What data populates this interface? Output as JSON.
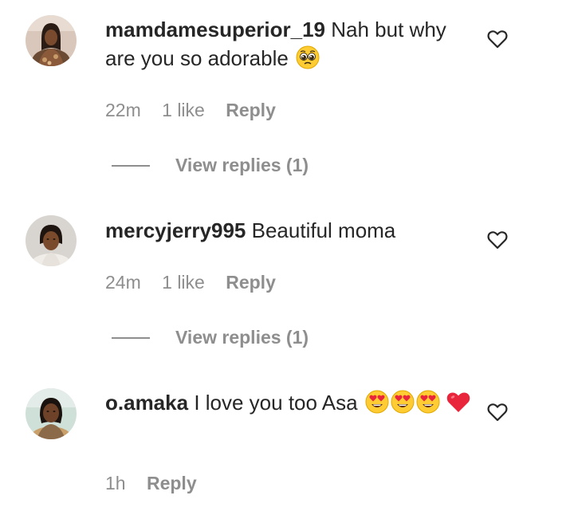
{
  "comments": [
    {
      "username": "mamdamesuperior_19",
      "text": "Nah but why are you so adorable",
      "emoji_icons": [
        "pleading-face-emoji"
      ],
      "time": "22m",
      "likes": "1 like",
      "reply_label": "Reply",
      "view_replies": "View replies (1)"
    },
    {
      "username": "mercyjerry995",
      "text": "Beautiful moma",
      "emoji_icons": [],
      "time": "24m",
      "likes": "1 like",
      "reply_label": "Reply",
      "view_replies": "View replies (1)"
    },
    {
      "username": "o.amaka",
      "text": "I love you too Asa",
      "emoji_icons": [
        "heart-eyes-emoji",
        "heart-eyes-emoji",
        "heart-eyes-emoji",
        "red-heart-emoji"
      ],
      "time": "1h",
      "reply_label": "Reply"
    }
  ],
  "icons": {
    "like": "heart-outline-icon"
  },
  "colors": {
    "text": "#262626",
    "secondary": "#8e8e8e",
    "emoji_yellow": "#ffcc33",
    "heart_red": "#e8253a"
  }
}
